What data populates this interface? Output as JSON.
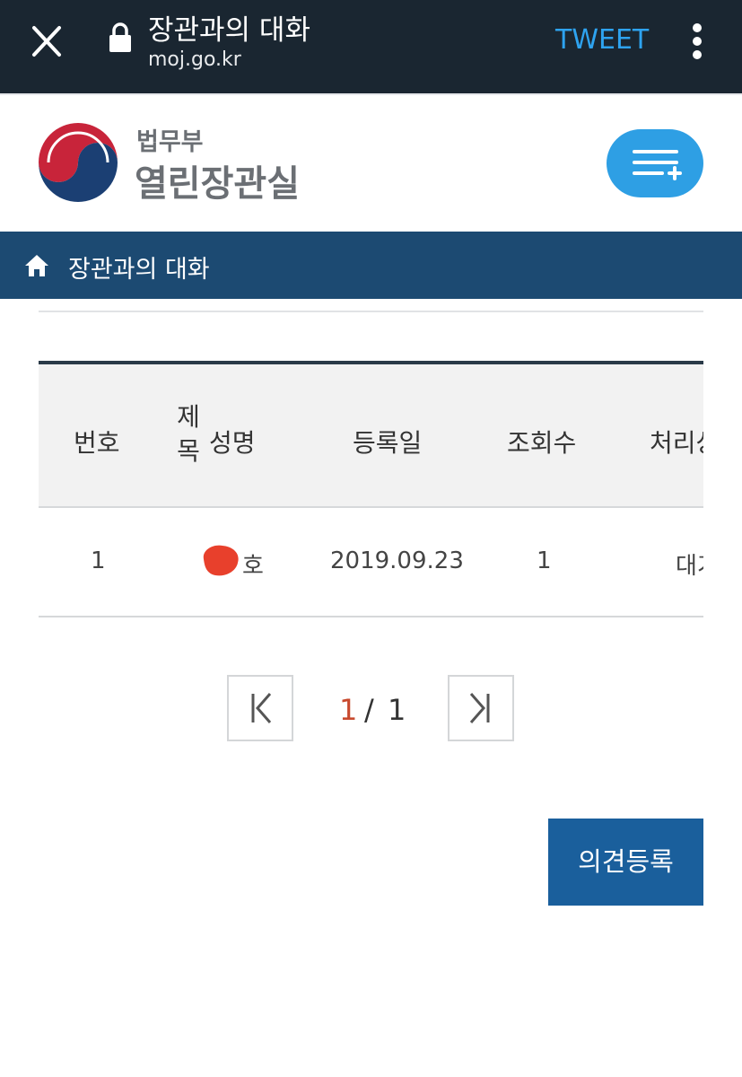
{
  "browser": {
    "title": "장관과의 대화",
    "url": "moj.go.kr",
    "tweet_label": "TWEET"
  },
  "header": {
    "ministry_name": "법무부",
    "site_name": "열린장관실"
  },
  "breadcrumb": {
    "label": "장관과의 대화"
  },
  "table": {
    "columns": {
      "number": "번호",
      "title": "제목",
      "name": "성명",
      "date": "등록일",
      "views": "조회수",
      "status": "처리상"
    },
    "rows": [
      {
        "number": "1",
        "name": "호",
        "date": "2019.09.23",
        "views": "1",
        "status": "대기"
      }
    ]
  },
  "pagination": {
    "current": "1",
    "separator": "/",
    "total": "1"
  },
  "actions": {
    "register_label": "의견등록"
  },
  "colors": {
    "browser_bar": "#1a2631",
    "tweet": "#2ea3f0",
    "menu_button": "#2e9fe4",
    "breadcrumb_bar": "#1c4a72",
    "register_button": "#1a5f9c",
    "current_page": "#c84a2e",
    "redaction": "#e8402c"
  }
}
